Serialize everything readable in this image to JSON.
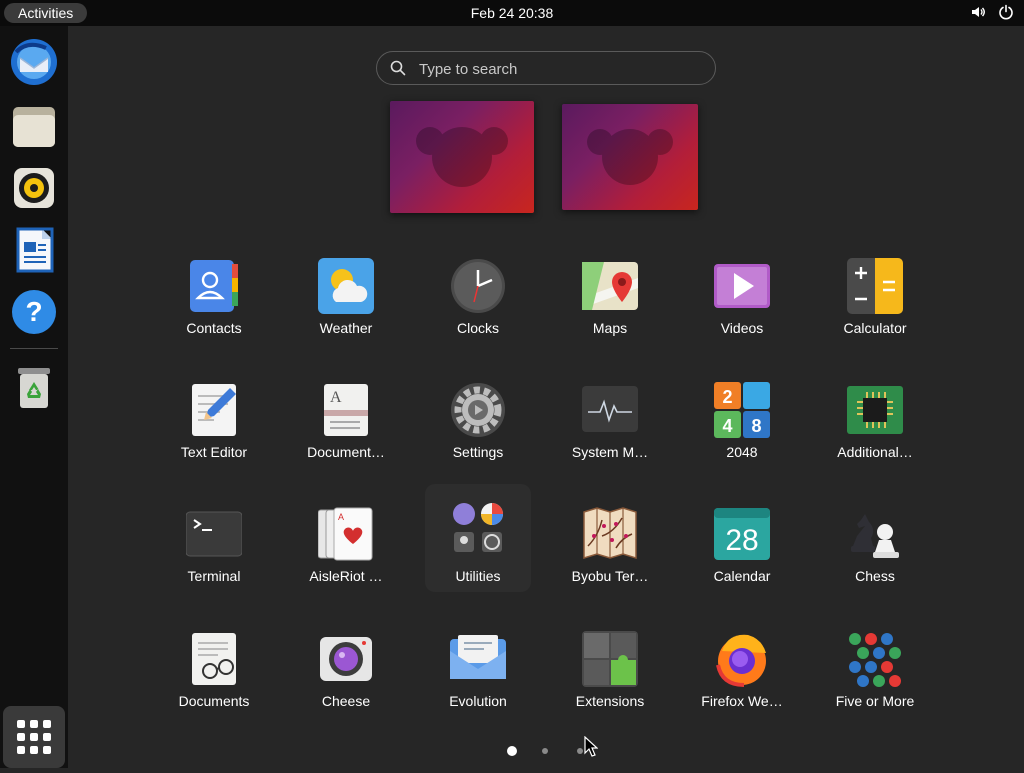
{
  "topbar": {
    "activities": "Activities",
    "clock": "Feb 24  20:38"
  },
  "search": {
    "placeholder": "Type to search"
  },
  "dash": [
    "Thunderbird Mail",
    "Files",
    "Rhythmbox",
    "LibreOffice Writer",
    "Help",
    "Trash"
  ],
  "apps": [
    "Contacts",
    "Weather",
    "Clocks",
    "Maps",
    "Videos",
    "Calculator",
    "Text Editor",
    "Document…",
    "Settings",
    "System M…",
    "2048",
    "Additional…",
    "Terminal",
    "AisleRiot …",
    "Utilities",
    "Byobu Ter…",
    "Calendar",
    "Chess",
    "Documents",
    "Cheese",
    "Evolution",
    "Extensions",
    "Firefox We…",
    "Five or More"
  ],
  "icons": {
    "calendar_day": "28",
    "game_2048": [
      "2",
      "4",
      "8"
    ]
  },
  "pages": {
    "count": 3,
    "current": 1
  }
}
